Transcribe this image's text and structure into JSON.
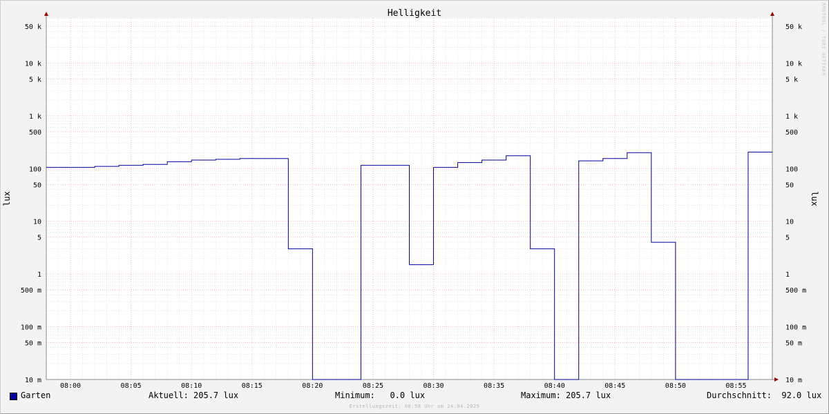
{
  "chart_data": {
    "type": "line",
    "title": "Helligkeit",
    "ylabel_left": "lux",
    "ylabel_right": "lux",
    "yscale": "log",
    "ylim": [
      10,
      80000
    ],
    "y_ticks": [
      {
        "value": 50000,
        "label": "50 k"
      },
      {
        "value": 10000,
        "label": "10 k"
      },
      {
        "value": 5000,
        "label": "5 k"
      },
      {
        "value": 1000,
        "label": "1 k"
      },
      {
        "value": 500,
        "label": "500"
      },
      {
        "value": 100,
        "label": "100"
      },
      {
        "value": 50,
        "label": "50"
      },
      {
        "value": 10,
        "label": "10"
      },
      {
        "value": 5,
        "label": "5"
      },
      {
        "value": 1,
        "label": "1"
      },
      {
        "value": 0.5,
        "label": "500 m"
      },
      {
        "value": 0.1,
        "label": "100 m"
      },
      {
        "value": 0.05,
        "label": "50 m"
      },
      {
        "value": 0.01,
        "label": "10 m"
      }
    ],
    "x_ticks": [
      "08:00",
      "08:05",
      "08:10",
      "08:15",
      "08:20",
      "08:25",
      "08:30",
      "08:35",
      "08:40",
      "08:45",
      "08:50",
      "08:55"
    ],
    "series": [
      {
        "name": "Garten",
        "color": "#00009c",
        "step": true,
        "points": [
          [
            "07:58",
            105
          ],
          [
            "08:00",
            105
          ],
          [
            "08:02",
            110
          ],
          [
            "08:04",
            115
          ],
          [
            "08:06",
            120
          ],
          [
            "08:08",
            135
          ],
          [
            "08:10",
            145
          ],
          [
            "08:12",
            150
          ],
          [
            "08:14",
            155
          ],
          [
            "08:18",
            3.0
          ],
          [
            "08:20",
            0.0
          ],
          [
            "08:24",
            115
          ],
          [
            "08:28",
            1.5
          ],
          [
            "08:30",
            105
          ],
          [
            "08:32",
            130
          ],
          [
            "08:34",
            145
          ],
          [
            "08:36",
            175
          ],
          [
            "08:38",
            3.0
          ],
          [
            "08:40",
            0.0
          ],
          [
            "08:42",
            140
          ],
          [
            "08:44",
            155
          ],
          [
            "08:46",
            200
          ],
          [
            "08:48",
            4.0
          ],
          [
            "08:50",
            0.0
          ],
          [
            "08:56",
            205.7
          ]
        ],
        "end": "08:58"
      }
    ]
  },
  "legend": {
    "series_name": "Garten",
    "current": "Aktuell: 205.7 lux",
    "minimum": "Minimum:   0.0 lux",
    "maximum": "Maximum: 205.7 lux",
    "average": "Durchschnitt:  92.0 lux"
  },
  "footer": "Erstellungszeit: 08:58 Uhr am 24.04.2025",
  "watermark": "RRDTOOL / TOBI OETIKER",
  "colors": {
    "series": "#00009c",
    "major_grid": "#f0a0a0",
    "minor_grid": "#d0d0d0",
    "axis_arrow": "#a00000",
    "plot_bg": "#ffffff"
  }
}
